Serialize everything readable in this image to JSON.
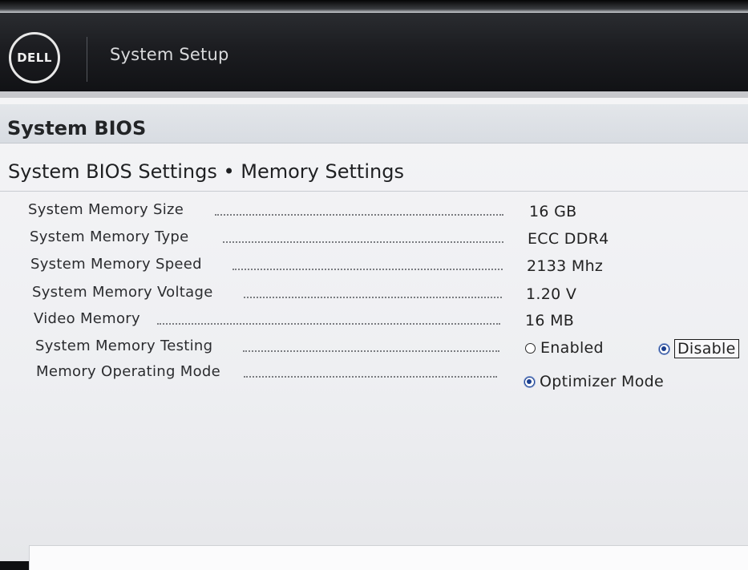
{
  "header": {
    "logo_text": "DELL",
    "title": "System Setup"
  },
  "bios_title": "System BIOS",
  "section_title": "System BIOS Settings • Memory Settings",
  "settings": [
    {
      "label": "System Memory Size",
      "value": "16 GB"
    },
    {
      "label": "System Memory Type",
      "value": "ECC DDR4"
    },
    {
      "label": "System Memory Speed",
      "value": "2133 Mhz"
    },
    {
      "label": "System Memory Voltage",
      "value": "1.20 V"
    },
    {
      "label": "Video Memory",
      "value": "16 MB"
    },
    {
      "label": "System Memory Testing",
      "options": [
        {
          "label": "Enabled",
          "selected": false
        },
        {
          "label": "Disable",
          "selected": true
        }
      ]
    },
    {
      "label": "Memory Operating Mode",
      "options": [
        {
          "label": "Optimizer Mode",
          "selected": true
        }
      ]
    }
  ],
  "colors": {
    "header_bg": "#1c1d21",
    "panel_bg": "#eeeff2",
    "radio_selected": "#1b3f8f"
  }
}
